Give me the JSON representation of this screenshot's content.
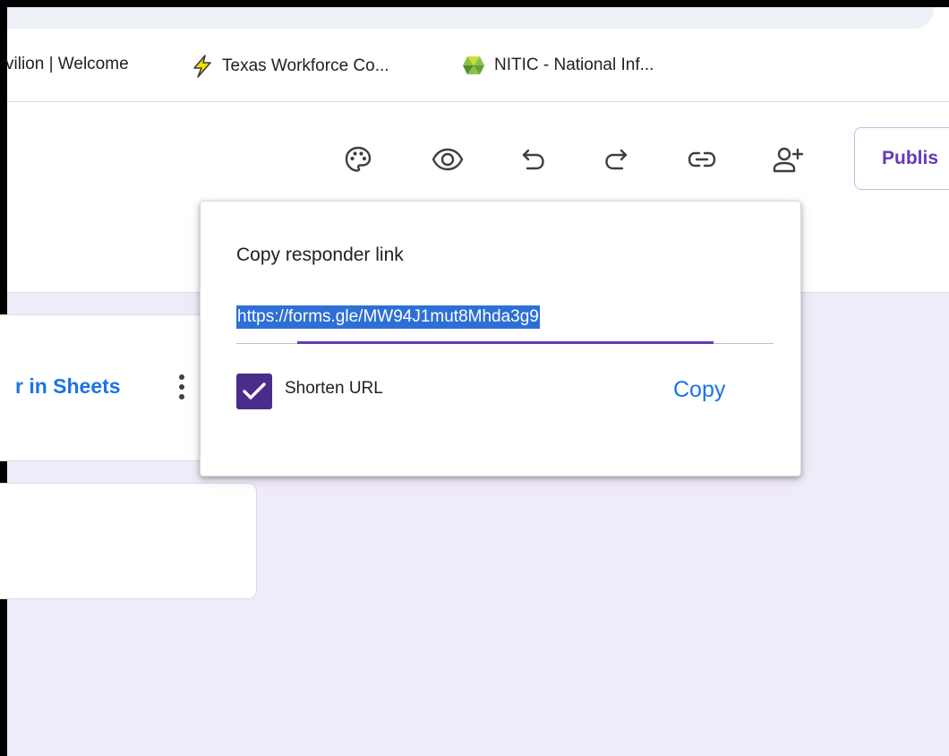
{
  "bookmarks": [
    {
      "label": "vilion | Welcome",
      "icon": "page-icon"
    },
    {
      "label": "Texas Workforce Co...",
      "icon": "lightning-icon"
    },
    {
      "label": "NITIC - National Inf...",
      "icon": "nitic-logo-icon"
    }
  ],
  "toolbar": {
    "icons": [
      "palette-icon",
      "preview-eye-icon",
      "undo-icon",
      "redo-icon",
      "link-icon",
      "add-collaborator-icon"
    ],
    "publish_label": "Publis"
  },
  "background": {
    "sheets_link_label": "r in Sheets"
  },
  "popup": {
    "title": "Copy responder link",
    "url": "https://forms.gle/MW94J1mut8Mhda3g9",
    "shorten_url_label": "Shorten URL",
    "shorten_url_checked": true,
    "copy_label": "Copy"
  },
  "colors": {
    "accent": "#673ab7",
    "canvas_bg": "#f0ebf8",
    "link_blue": "#1a73e8",
    "checkbox": "#4b2c8a",
    "selection": "#2d6fd5"
  }
}
